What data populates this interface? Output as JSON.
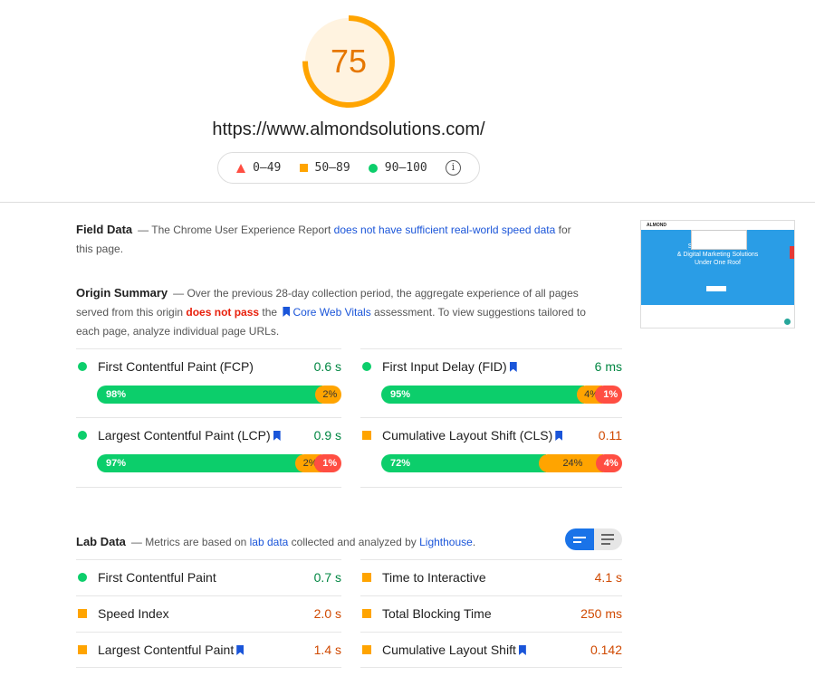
{
  "score": {
    "value": "75",
    "fraction": 0.75,
    "color": "#ffa400"
  },
  "url": "https://www.almondsolutions.com/",
  "legend": {
    "fail": "0–49",
    "average": "50–89",
    "pass": "90–100",
    "info_icon": "info-icon"
  },
  "field_data": {
    "title": "Field Data",
    "text_before": "— The Chrome User Experience Report ",
    "link": "does not have sufficient real-world speed data",
    "text_after": " for this page."
  },
  "origin_summary": {
    "title": "Origin Summary",
    "text1": "— Over the previous 28-day collection period, the aggregate experience of all pages served from this origin ",
    "status": "does not pass",
    "text2": " the ",
    "link": "Core Web Vitals",
    "text3": " assessment. To view suggestions tailored to each page, analyze individual page URLs.",
    "metrics": [
      {
        "name": "First Contentful Paint (FCP)",
        "value": "0.6 s",
        "rating": "pass",
        "core": false,
        "dist": [
          "98%",
          "2%",
          ""
        ],
        "fr": [
          98,
          2,
          0
        ]
      },
      {
        "name": "First Input Delay (FID)",
        "value": "6 ms",
        "rating": "pass",
        "core": true,
        "dist": [
          "95%",
          "4%",
          "1%"
        ],
        "fr": [
          95,
          4,
          1
        ]
      },
      {
        "name": "Largest Contentful Paint (LCP)",
        "value": "0.9 s",
        "rating": "pass",
        "core": true,
        "dist": [
          "97%",
          "2%",
          "1%"
        ],
        "fr": [
          97,
          2,
          1
        ]
      },
      {
        "name": "Cumulative Layout Shift (CLS)",
        "value": "0.11",
        "rating": "average",
        "core": true,
        "dist": [
          "72%",
          "24%",
          "4%"
        ],
        "fr": [
          72,
          24,
          4
        ]
      }
    ]
  },
  "lab_data": {
    "title": "Lab Data",
    "text1": "— Metrics are based on ",
    "link1": "lab data",
    "text2": " collected and analyzed by ",
    "link2": "Lighthouse",
    "text3": ".",
    "metrics": [
      {
        "name": "First Contentful Paint",
        "value": "0.7 s",
        "rating": "pass",
        "core": false
      },
      {
        "name": "Time to Interactive",
        "value": "4.1 s",
        "rating": "average",
        "core": false
      },
      {
        "name": "Speed Index",
        "value": "2.0 s",
        "rating": "average",
        "core": false
      },
      {
        "name": "Total Blocking Time",
        "value": "250 ms",
        "rating": "average",
        "core": false
      },
      {
        "name": "Largest Contentful Paint",
        "value": "1.4 s",
        "rating": "average",
        "core": true
      },
      {
        "name": "Cumulative Layout Shift",
        "value": "0.142",
        "rating": "average",
        "core": true
      }
    ]
  },
  "thumbnail": {
    "headline1": "SEO Website Design",
    "headline2": "& Digital Marketing Solutions",
    "headline3": "Under One Roof",
    "logo": "ALMOND"
  },
  "colors": {
    "pass": "#0cce6b",
    "average": "#ffa400",
    "fail": "#ff4e42",
    "link": "#1a55d9"
  }
}
